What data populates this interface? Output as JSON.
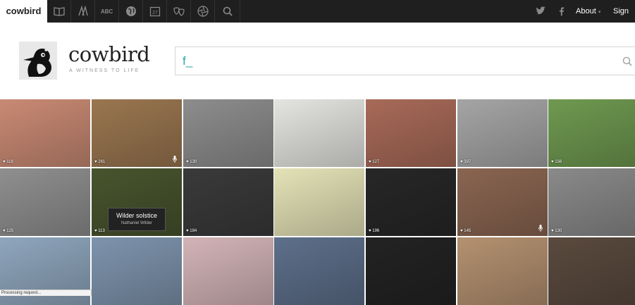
{
  "brand": {
    "name": "cowbird",
    "tagline": "A WITNESS TO LIFE"
  },
  "nav": {
    "icons": [
      "book-icon",
      "people-icon",
      "abc-letters-icon",
      "globe-icon",
      "calendar-27-icon",
      "theater-masks-icon",
      "aperture-icon",
      "search-icon"
    ],
    "calendar_day": "27",
    "abc_label": "ABC",
    "about_label": "About",
    "signin_label": "Sign in",
    "social_icons": [
      "twitter-icon",
      "facebook-icon"
    ]
  },
  "search": {
    "value": "f_"
  },
  "tiles": [
    {
      "count": "♥ 118",
      "mic": false,
      "color": "#c98a74"
    },
    {
      "count": "♥ 261",
      "mic": true,
      "color": "#9a7650"
    },
    {
      "count": "♥ 130",
      "mic": false,
      "color": "#8d8d8d"
    },
    {
      "count": "",
      "mic": false,
      "color": "#e4e4e0"
    },
    {
      "count": "♥ 127",
      "mic": false,
      "color": "#a86a58"
    },
    {
      "count": "♥ 397",
      "mic": false,
      "color": "#a5a5a5"
    },
    {
      "count": "♥ 156",
      "mic": false,
      "color": "#6f9950"
    },
    {
      "count": "♥ 125",
      "mic": false,
      "color": "#8f8f8f"
    },
    {
      "count": "♥ 113",
      "mic": false,
      "color": "#48542e"
    },
    {
      "count": "♥ 184",
      "mic": false,
      "color": "#3a3a3a"
    },
    {
      "count": "",
      "mic": false,
      "color": "#e4e2b6"
    },
    {
      "count": "♥ 196",
      "mic": false,
      "color": "#272727"
    },
    {
      "count": "♥ 145",
      "mic": true,
      "color": "#8a6551"
    },
    {
      "count": "♥ 130",
      "mic": false,
      "color": "#8a8a8a"
    },
    {
      "count": "",
      "mic": false,
      "color": "#8fa6bd"
    },
    {
      "count": "",
      "mic": false,
      "color": "#7e94ad"
    },
    {
      "count": "",
      "mic": false,
      "color": "#d3b4b7"
    },
    {
      "count": "",
      "mic": false,
      "color": "#5d6f8a"
    },
    {
      "count": "",
      "mic": false,
      "color": "#232323"
    },
    {
      "count": "",
      "mic": false,
      "color": "#b49170"
    },
    {
      "count": "",
      "mic": false,
      "color": "#5a4a3e"
    }
  ],
  "tooltip": {
    "title": "Wilder solstice",
    "author": "Nathaniel Wilder"
  },
  "status": {
    "text": "Processing request..."
  }
}
